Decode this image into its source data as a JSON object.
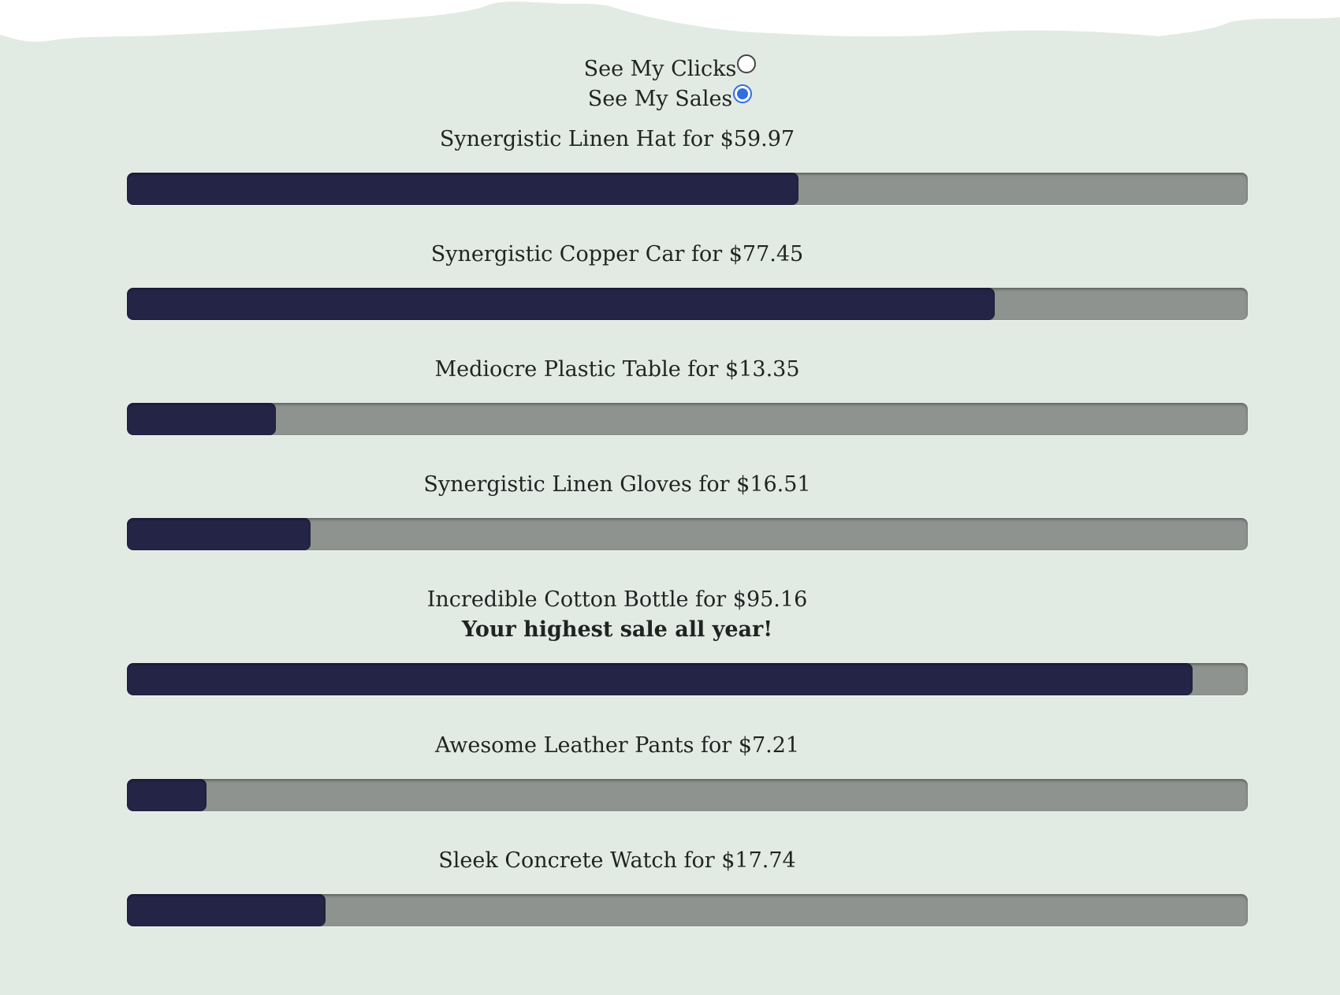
{
  "view_toggle": {
    "clicks_label": "See My Clicks",
    "clicks_selected": false,
    "sales_label": "See My Sales",
    "sales_selected": true
  },
  "colors": {
    "background": "#e2eae4",
    "bar_track": "#8e9390",
    "bar_fill": "#232446",
    "radio_selected": "#2f6fe0"
  },
  "sales": [
    {
      "label": "Synergistic Linen Hat for $59.97",
      "fill_percent": 59.9
    },
    {
      "label": "Synergistic Copper Car for $77.45",
      "fill_percent": 77.4
    },
    {
      "label": "Mediocre Plastic Table for $13.35",
      "fill_percent": 13.3
    },
    {
      "label": "Synergistic Linen Gloves for $16.51",
      "fill_percent": 16.4
    },
    {
      "label": "Incredible Cotton Bottle for $95.16",
      "note": "Your highest sale all year!",
      "fill_percent": 95.1
    },
    {
      "label": "Awesome Leather Pants for $7.21",
      "fill_percent": 7.1
    },
    {
      "label": "Sleek Concrete Watch for $17.74",
      "fill_percent": 17.7
    }
  ]
}
